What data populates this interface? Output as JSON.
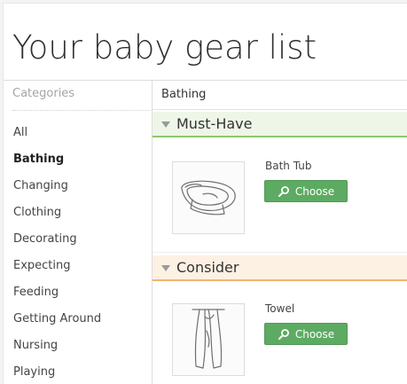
{
  "page": {
    "title": "Your baby gear list"
  },
  "sidebar": {
    "header": "Categories",
    "items": [
      {
        "label": "All",
        "active": false
      },
      {
        "label": "Bathing",
        "active": true
      },
      {
        "label": "Changing",
        "active": false
      },
      {
        "label": "Clothing",
        "active": false
      },
      {
        "label": "Decorating",
        "active": false
      },
      {
        "label": "Expecting",
        "active": false
      },
      {
        "label": "Feeding",
        "active": false
      },
      {
        "label": "Getting Around",
        "active": false
      },
      {
        "label": "Nursing",
        "active": false
      },
      {
        "label": "Playing",
        "active": false
      }
    ]
  },
  "main": {
    "section_title": "Bathing",
    "groups": [
      {
        "label": "Must-Have",
        "color": "#8dc86b",
        "items": [
          {
            "name": "Bath Tub",
            "button_label": "Choose",
            "icon": "bath-tub-sketch"
          }
        ]
      },
      {
        "label": "Consider",
        "color": "#f2b46a",
        "items": [
          {
            "name": "Towel",
            "button_label": "Choose",
            "icon": "towel-sketch"
          }
        ]
      }
    ]
  },
  "colors": {
    "button": "#5dab63",
    "must_have_accent": "#8dc86b",
    "consider_accent": "#f2b46a"
  }
}
